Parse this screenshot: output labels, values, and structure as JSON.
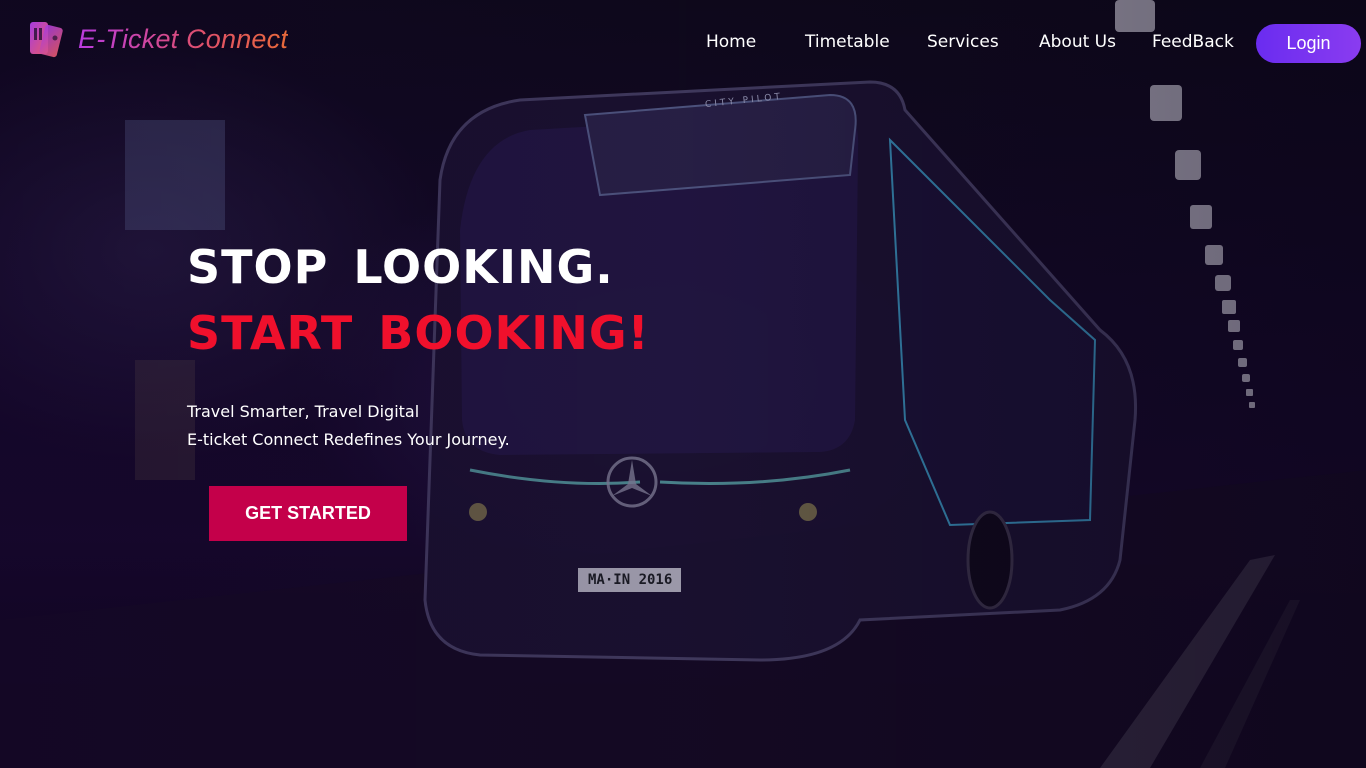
{
  "brand": {
    "name": "E-Ticket Connect",
    "icon": "ticket-icon"
  },
  "nav": {
    "items": [
      {
        "label": "Home"
      },
      {
        "label": "Timetable"
      },
      {
        "label": "Services"
      },
      {
        "label": "About Us"
      },
      {
        "label": "FeedBack"
      }
    ],
    "login_label": "Login"
  },
  "hero": {
    "headline_line1": "STOP  LOOKING.",
    "headline_line2": "START  BOOKING!",
    "tagline_line1": "Travel Smarter, Travel Digital",
    "tagline_line2": "E-ticket Connect Redefines Your Journey.",
    "cta_label": "GET STARTED"
  },
  "background": {
    "plate_text": "MA·IN 2016",
    "bus_side_text": "CITY PILOT"
  },
  "colors": {
    "accent_red": "#f0102c",
    "cta_bg": "#c4004a",
    "login_gradient_start": "#6a2cf0",
    "login_gradient_end": "#8a3cf0"
  }
}
